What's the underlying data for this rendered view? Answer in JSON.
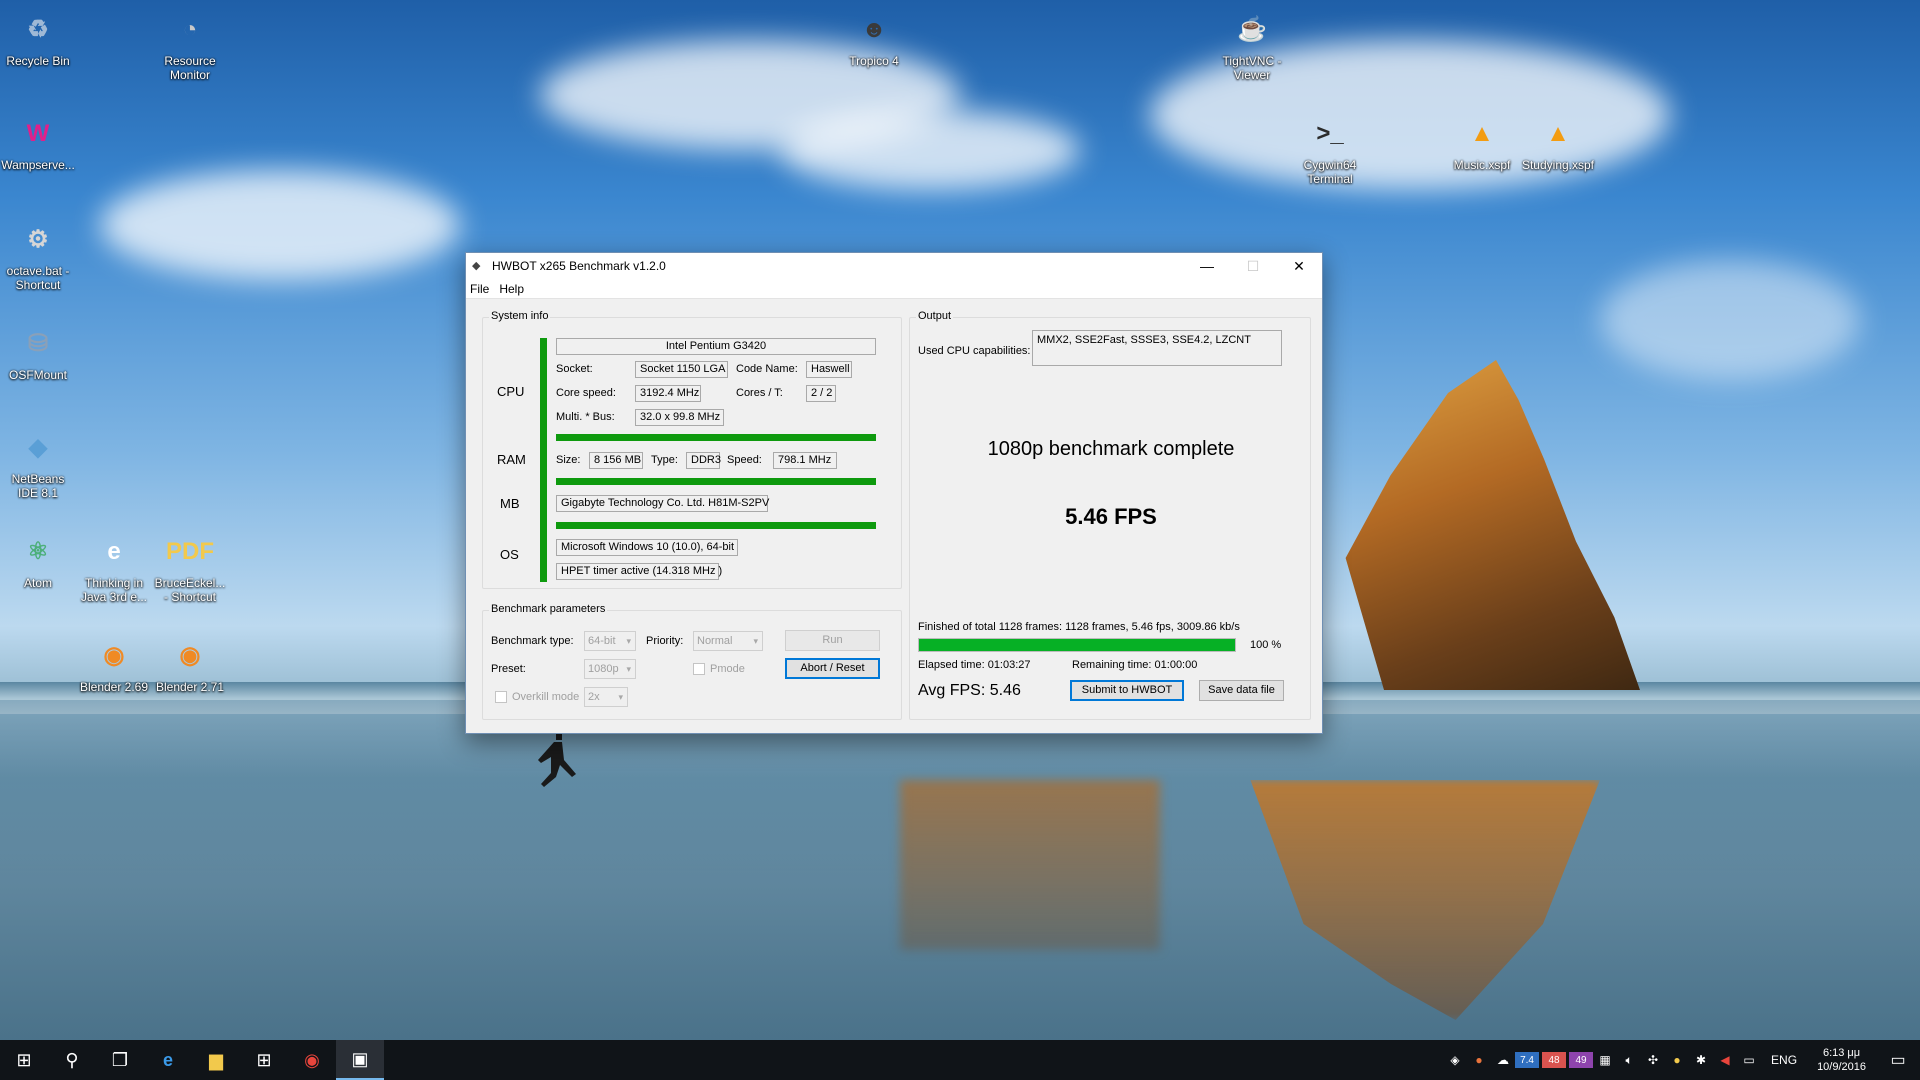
{
  "desktop": {
    "icons": [
      {
        "label": "Recycle Bin",
        "glyph": "♻",
        "color": "#9fb9d6"
      },
      {
        "label": "Resource Monitor",
        "glyph": "◔",
        "color": "#c9c9c9"
      },
      {
        "label": "Wampserve...",
        "glyph": "W",
        "color": "#e0208a"
      },
      {
        "label": "octave.bat - Shortcut",
        "glyph": "⚙",
        "color": "#d6d6d6"
      },
      {
        "label": "OSFMount",
        "glyph": "⛁",
        "color": "#8aa0b8"
      },
      {
        "label": "NetBeans IDE 8.1",
        "glyph": "◆",
        "color": "#5a9fd6"
      },
      {
        "label": "Atom",
        "glyph": "⚛",
        "color": "#4caf7a"
      },
      {
        "label": "Thinking in Java 3rd e...",
        "glyph": "e",
        "color": "#ffffff"
      },
      {
        "label": "BruceEckel... - Shortcut",
        "glyph": "PDF",
        "color": "#f2c94c"
      },
      {
        "label": "Blender 2.69",
        "glyph": "◉",
        "color": "#f08a24"
      },
      {
        "label": "Blender 2.71",
        "glyph": "◉",
        "color": "#f08a24"
      },
      {
        "label": "Tropico 4",
        "glyph": "☻",
        "color": "#3a3a3a"
      },
      {
        "label": "TightVNC - Viewer",
        "glyph": "☕",
        "color": "#ffffff"
      },
      {
        "label": "Cygwin64 Terminal",
        "glyph": ">_",
        "color": "#2b2b2b"
      },
      {
        "label": "Music.xspf",
        "glyph": "▲",
        "color": "#f39c12"
      },
      {
        "label": "Studying.xspf",
        "glyph": "▲",
        "color": "#f39c12"
      }
    ]
  },
  "window": {
    "title": "HWBOT x265 Benchmark v1.2.0",
    "controls": {
      "minimize": "—",
      "maximize": "☐",
      "close": "✕"
    },
    "menu": [
      "File",
      "Help"
    ]
  },
  "system_info": {
    "group_label": "System info",
    "cpu": {
      "section": "CPU",
      "name": "Intel Pentium G3420",
      "socket_label": "Socket:",
      "socket": "Socket 1150 LGA",
      "codename_label": "Code Name:",
      "codename": "Haswell",
      "speed_label": "Core speed:",
      "speed": "3192.4 MHz",
      "cores_label": "Cores / T:",
      "cores": "2 / 2",
      "multi_label": "Multi. * Bus:",
      "multi": "32.0 x 99.8 MHz"
    },
    "ram": {
      "section": "RAM",
      "size_label": "Size:",
      "size": "8 156 MB",
      "type_label": "Type:",
      "type": "DDR3",
      "speed_label": "Speed:",
      "speed": "798.1 MHz"
    },
    "mb": {
      "section": "MB",
      "name": "Gigabyte Technology Co. Ltd. H81M-S2PV"
    },
    "os": {
      "section": "OS",
      "name": "Microsoft Windows 10 (10.0), 64-bit",
      "timer": "HPET timer active (14.318 MHz )"
    }
  },
  "benchmark_params": {
    "group_label": "Benchmark parameters",
    "type_label": "Benchmark type:",
    "type_value": "64-bit",
    "priority_label": "Priority:",
    "priority_value": "Normal",
    "run_label": "Run",
    "preset_label": "Preset:",
    "preset_value": "1080p",
    "pmode_label": "Pmode",
    "abort_label": "Abort / Reset",
    "overkill_label": "Overkill mode",
    "overkill_value": "2x"
  },
  "output": {
    "group_label": "Output",
    "cpu_caps_label": "Used CPU capabilities:",
    "cpu_caps": "MMX2, SSE2Fast, SSSE3, SSE4.2, LZCNT",
    "status": "1080p benchmark complete",
    "fps": "5.46 FPS",
    "summary": "Finished of total 1128 frames: 1128 frames, 5.46 fps,  3009.86 kb/s",
    "progress_value": 100,
    "progress_text": "100 %",
    "elapsed": "Elapsed time: 01:03:27",
    "remaining": "Remaining time: 01:00:00",
    "avg_fps": "Avg FPS: 5.46",
    "submit_label": "Submit to HWBOT",
    "save_label": "Save data file"
  },
  "taskbar": {
    "tray_badges": [
      "7.4",
      "48",
      "49"
    ],
    "language": "ENG",
    "time": "6:13 μμ",
    "date": "10/9/2016"
  }
}
